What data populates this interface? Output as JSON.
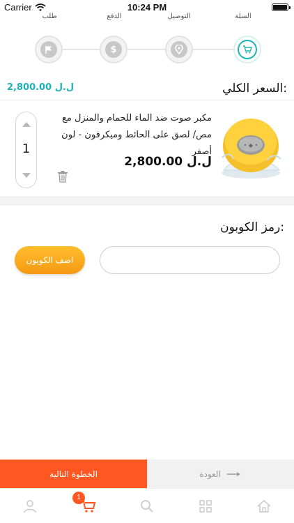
{
  "status_bar": {
    "carrier": "Carrier",
    "time": "10:24 PM"
  },
  "steps": [
    {
      "label": "السلة",
      "icon": "cart-icon",
      "active": true
    },
    {
      "label": "التوصيل",
      "icon": "location-pin-icon",
      "active": false
    },
    {
      "label": "الدفع",
      "icon": "dollar-icon",
      "active": false
    },
    {
      "label": "طلب",
      "icon": "flag-icon",
      "active": false
    }
  ],
  "summary": {
    "total_label": "السعر الكلي:",
    "total_value": "2,800.00 ل.ل"
  },
  "cart_item": {
    "title": "مكبر صوت ضد الماء للحمام والمنزل مع مص/ لصق على الحائط  وميكرفون   - لون أصفر",
    "price": "2,800.00 ل.ل",
    "quantity": "1",
    "image_icon": "yellow-speaker-product-image"
  },
  "coupon": {
    "label": "رمز الكوبون:",
    "input_value": "",
    "placeholder": "",
    "button_label": "اضف الكوبون"
  },
  "actions": {
    "next_label": "الخطوة التالية",
    "back_label": "العودة"
  },
  "tab_bar": {
    "items": [
      "home-icon",
      "categories-icon",
      "search-icon",
      "cart-icon",
      "profile-icon"
    ],
    "cart_badge": "1"
  },
  "colors": {
    "accent": "#1bb3b8",
    "primary": "#ff5722",
    "coupon": "#f7a31a"
  }
}
